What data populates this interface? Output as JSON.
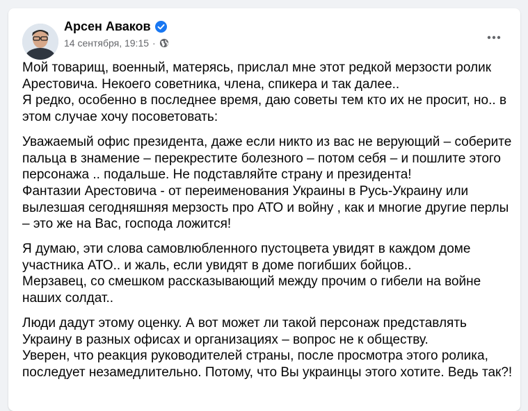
{
  "post": {
    "author": "Арсен Аваков",
    "date": "14 сентября, 19:15",
    "separator": "·",
    "privacy_icon": "globe-icon",
    "verified_icon": "verified-badge-icon",
    "more_icon": "more-options-icon",
    "accent_color": "#1877f2",
    "paragraphs": [
      [
        "Мой товарищ, военный, матерясь, прислал мне этот редкой мерзости ролик",
        "Арестовича. Некоего советника, члена, спикера и так далее..",
        "Я редко, особенно в последнее время, даю советы тем кто их не просит, но.. в",
        "этом случае хочу посоветовать:"
      ],
      [
        "Уважаемый офис президента, даже если никто из вас не верующий – соберите",
        "пальца в знамение – перекрестите болезного – потом себя – и пошлите этого",
        "персонажа .. подальше. Не подставляйте страну и президента!",
        "Фантазии Арестовича - от переименования Украины в Русь-Украину или",
        "вылезшая сегодняшняя мерзость про АТО и войну , как и многие другие перлы",
        "– это же на Вас, господа ложится!"
      ],
      [
        "Я думаю, эти слова самовлюбленного пустоцвета увидят в каждом доме",
        "участника АТО.. и жаль, если увидят в доме погибших бойцов..",
        "Мерзавец, со смешком рассказывающий между прочим о гибели на войне",
        "наших солдат.."
      ],
      [
        "Люди дадут этому оценку. А вот может ли такой персонаж представлять",
        "Украину в разных офисах и организациях – вопрос не к обществу.",
        "Уверен, что реакция руководителей страны, после просмотра этого ролика,",
        "последует незамедлительно. Потому, что Вы украинцы этого хотите. Ведь так?!"
      ]
    ]
  }
}
